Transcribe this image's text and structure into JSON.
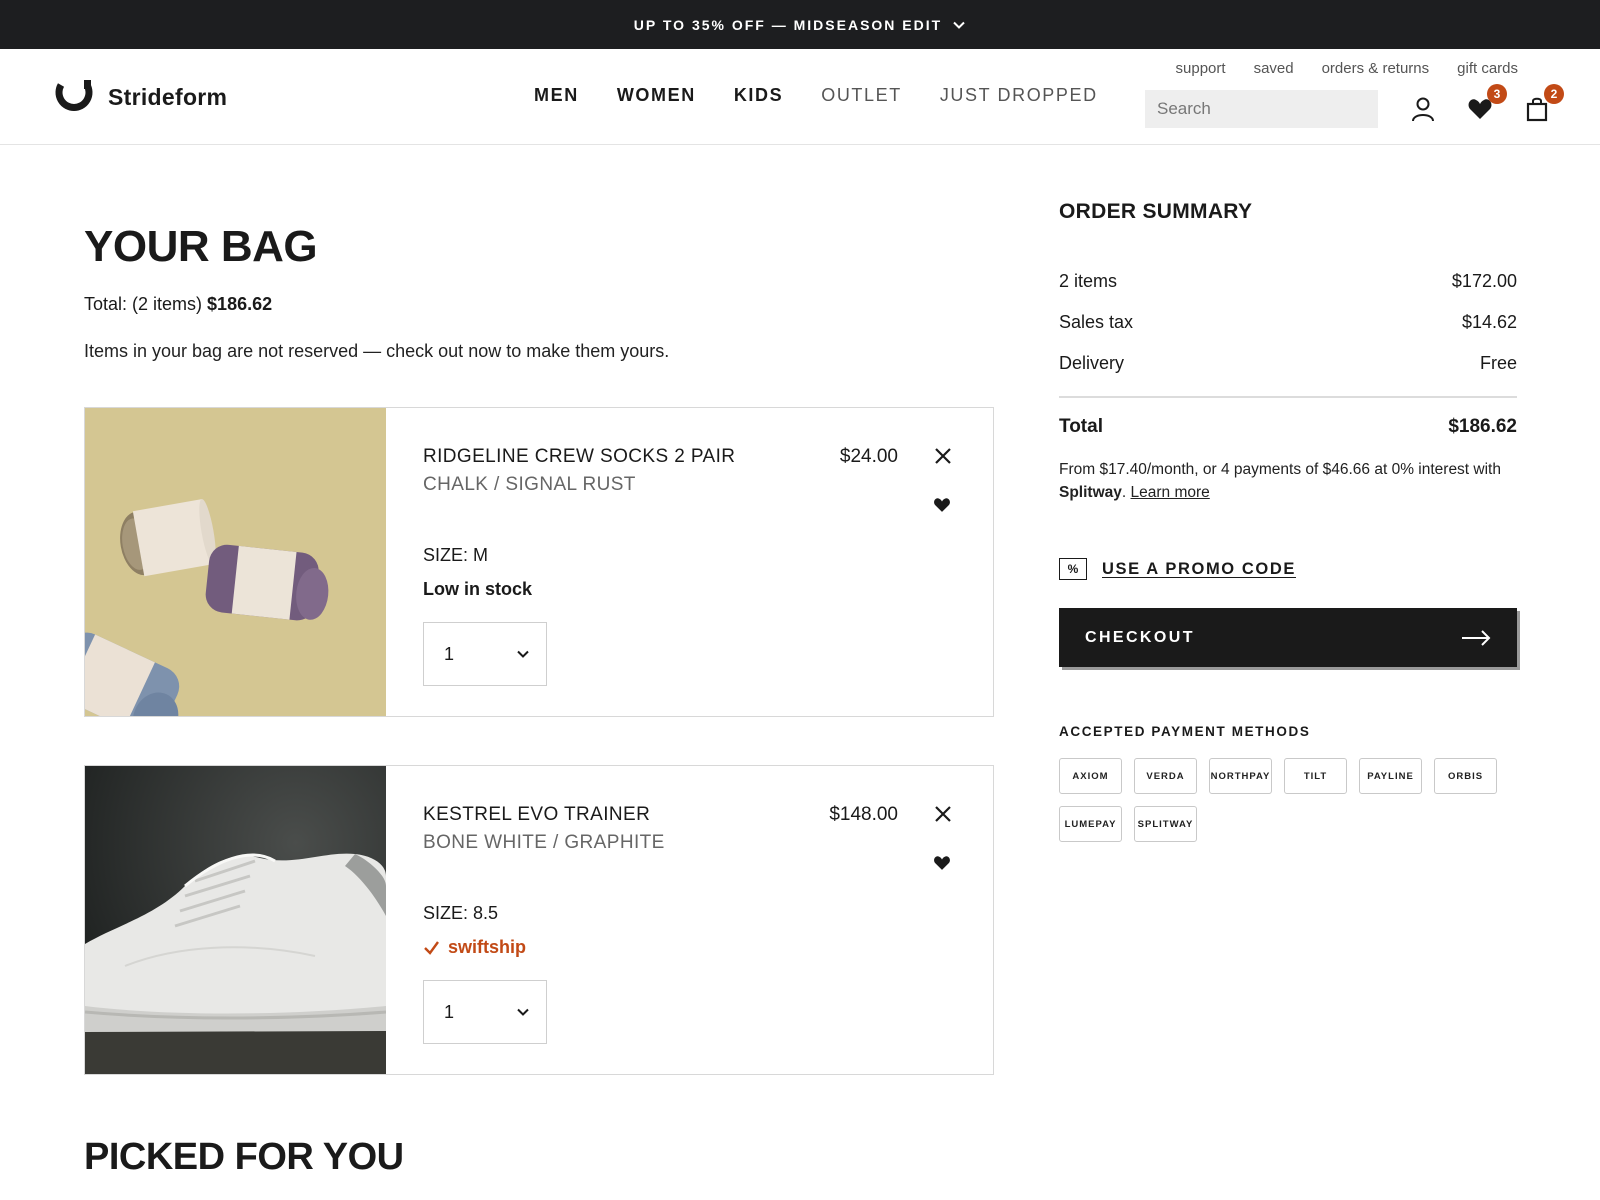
{
  "promo_bar": {
    "text": "UP TO 35% OFF — MIDSEASON EDIT"
  },
  "header": {
    "brand": "Strideform",
    "nav": [
      "MEN",
      "WOMEN",
      "KIDS",
      "OUTLET",
      "JUST DROPPED"
    ],
    "utility_links": [
      "support",
      "saved",
      "orders & returns",
      "gift cards"
    ],
    "search_placeholder": "Search",
    "wishlist_count": "3",
    "bag_count": "2",
    "badge_color": "#c24a16"
  },
  "bag": {
    "title": "YOUR BAG",
    "total_label": "Total: (2 items)",
    "total_value": "$186.62",
    "note": "Items in your bag are not reserved — check out now to make them yours.",
    "items": [
      {
        "name": "RIDGELINE CREW SOCKS 2 PAIR",
        "color": "CHALK / SIGNAL RUST",
        "price": "$24.00",
        "size": "SIZE: M",
        "stock": "Low in stock",
        "quantity": "1",
        "image_icon": "socks-photo"
      },
      {
        "name": "KESTREL EVO TRAINER",
        "color": "BONE WHITE / GRAPHITE",
        "price": "$148.00",
        "size": "SIZE: 8.5",
        "shipping": "swiftship",
        "quantity": "1",
        "image_icon": "sneaker-photo"
      }
    ]
  },
  "picked_for_you": {
    "title": "PICKED FOR YOU"
  },
  "summary": {
    "title": "ORDER SUMMARY",
    "rows": [
      {
        "label": "2 items",
        "value": "$172.00"
      },
      {
        "label": "Sales tax",
        "value": "$14.62"
      },
      {
        "label": "Delivery",
        "value": "Free"
      }
    ],
    "total_label": "Total",
    "total_value": "$186.62",
    "installment_text": "From $17.40/month, or 4 payments of $46.66 at 0% interest with",
    "installment_brand": "Splitway",
    "installment_link": "Learn more",
    "promo_code_label": "USE A PROMO CODE",
    "checkout_label": "CHECKOUT",
    "payment_title": "ACCEPTED PAYMENT METHODS",
    "payment_methods": [
      "AXIOM",
      "VERDA",
      "NORTHPAY",
      "TILT",
      "PAYLINE",
      "ORBIS",
      "LUMEPAY",
      "SPLITWAY"
    ]
  }
}
